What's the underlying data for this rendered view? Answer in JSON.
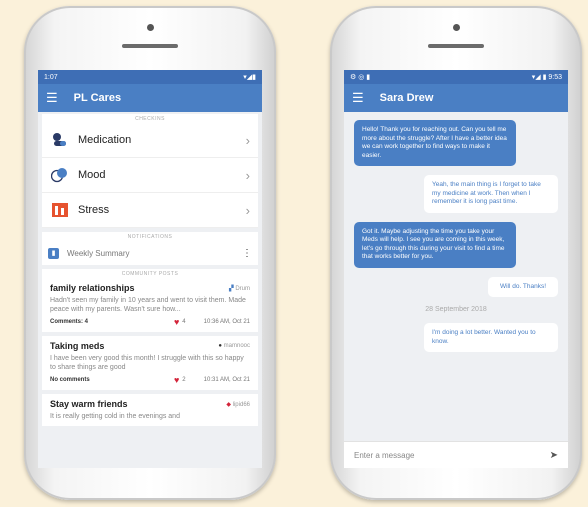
{
  "left": {
    "status": {
      "time": "1:07",
      "right": "▾◢▮"
    },
    "appbar": {
      "title": "PL Cares"
    },
    "checkins_label": "CHECKINS",
    "checkins": [
      {
        "label": "Medication",
        "icon": "pills-icon"
      },
      {
        "label": "Mood",
        "icon": "mood-faces-icon"
      },
      {
        "label": "Stress",
        "icon": "stress-bars-icon"
      }
    ],
    "notifications_label": "NOTIFICATIONS",
    "notification": {
      "label": "Weekly Summary"
    },
    "community_label": "COMMUNITY POSTS",
    "posts": [
      {
        "title": "family relationships",
        "author": "Drum",
        "body": "Hadn't seen my family in 10 years and went to visit them. Made peace with my parents. Wasn't sure how...",
        "comments": "Comments: 4",
        "likes": "4",
        "time": "10:36 AM, Oct 21"
      },
      {
        "title": "Taking meds",
        "author": "mamnooc",
        "body": "I have been very good this month! I struggle with this so happy to share things are good",
        "comments": "No comments",
        "likes": "2",
        "time": "10:31 AM, Oct 21"
      },
      {
        "title": "Stay warm friends",
        "author": "lipid66",
        "body": "It is really getting cold in the evenings and",
        "comments": "",
        "likes": "",
        "time": ""
      }
    ]
  },
  "right": {
    "status": {
      "right": "▾◢ ▮ 9:53"
    },
    "appbar": {
      "title": "Sara Drew"
    },
    "messages": [
      {
        "dir": "in",
        "text": "Hello! Thank you for reaching out. Can you tell me more about the struggle? After I have a better idea we can work together to find ways to make it easier."
      },
      {
        "dir": "out",
        "text": "Yeah, the main thing is I forget to take my medicine at work. Then when I remember it is long past time."
      },
      {
        "dir": "in",
        "text": "Got it. Maybe adjusting the time you take your Meds will help. I see you are coming in this week, let's go through this during your visit to find a time that works better for you."
      },
      {
        "dir": "out",
        "text": "Will do. Thanks!"
      }
    ],
    "date_sep": "28 September 2018",
    "last_message": "I'm doing a lot better. Wanted you to know.",
    "compose_placeholder": "Enter a message"
  },
  "colors": {
    "primary": "#4a7fc4",
    "status": "#3e6eb5",
    "heart": "#d3243a",
    "background": "#fbf1da"
  }
}
